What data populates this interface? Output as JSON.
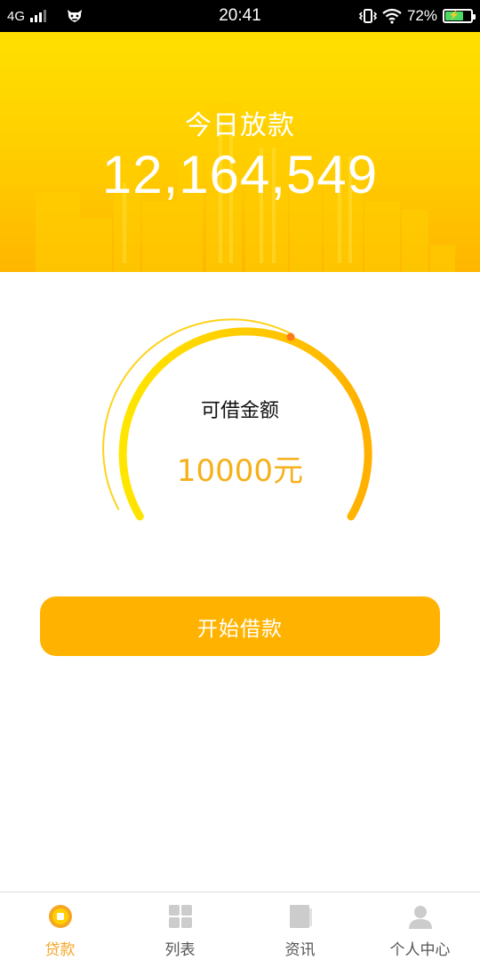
{
  "status_bar": {
    "network": "4G",
    "time": "20:41",
    "battery_percent": "72%",
    "battery_level": 0.72
  },
  "banner": {
    "title": "今日放款",
    "amount": "12,164,549"
  },
  "gauge": {
    "label": "可借金额",
    "amount": "10000元"
  },
  "actions": {
    "borrow_label": "开始借款"
  },
  "tab_bar": {
    "items": [
      {
        "label": "贷款",
        "icon": "loan-icon",
        "active": true
      },
      {
        "label": "列表",
        "icon": "grid-icon",
        "active": false
      },
      {
        "label": "资讯",
        "icon": "news-icon",
        "active": false
      },
      {
        "label": "个人中心",
        "icon": "user-icon",
        "active": false
      }
    ]
  },
  "colors": {
    "accent": "#ffb300",
    "accent_text": "#f5a623",
    "banner_top": "#ffe000",
    "banner_bottom": "#ffb600",
    "gauge_dot": "#ff7a1a"
  }
}
